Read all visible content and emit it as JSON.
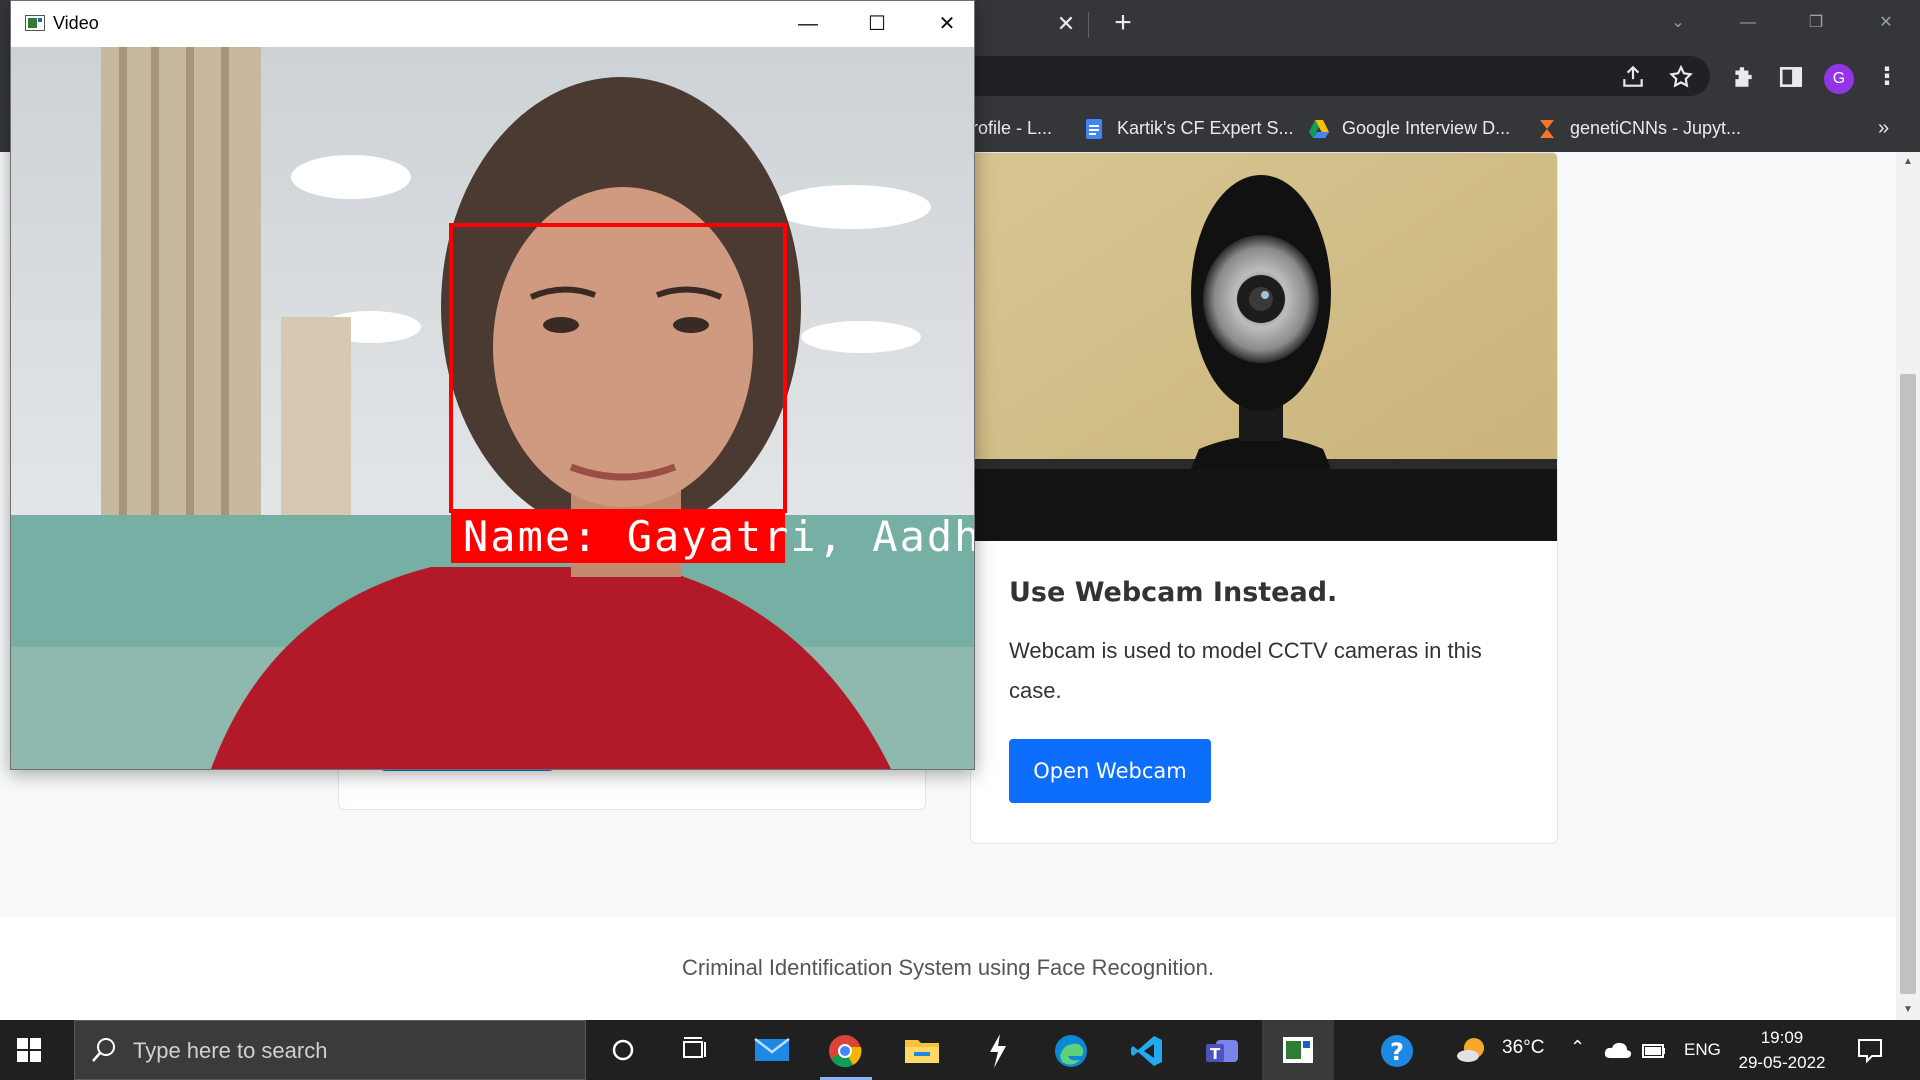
{
  "browser": {
    "bookmarks": [
      {
        "label": "rofile - L...",
        "icon": "partial-icon"
      },
      {
        "label": "Kartik's CF Expert S...",
        "icon": "google-docs-icon"
      },
      {
        "label": "Google Interview D...",
        "icon": "google-drive-icon"
      },
      {
        "label": "genetiCNNs - Jupyt...",
        "icon": "jupyter-icon"
      }
    ],
    "more_bookmarks": "»",
    "avatar_initial": "G"
  },
  "video_window": {
    "title": "Video",
    "overlay_label": "Name: Gayatri, Aadha"
  },
  "card": {
    "title": "Use Webcam Instead.",
    "text": "Webcam is used to model CCTV cameras in this case.",
    "button": "Open Webcam"
  },
  "footer": {
    "text": "Criminal Identification System using Face Recognition."
  },
  "taskbar": {
    "search_placeholder": "Type here to search",
    "weather": "36°C",
    "language": "ENG",
    "time": "19:09",
    "date": "29-05-2022"
  },
  "colors": {
    "accent": "#0d6efd",
    "face_box": "#ff0000"
  }
}
